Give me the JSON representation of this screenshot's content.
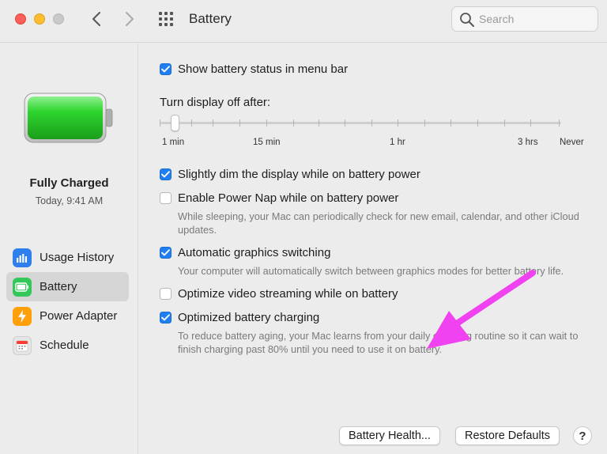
{
  "window": {
    "title": "Battery"
  },
  "search": {
    "placeholder": "Search"
  },
  "sidebar": {
    "status_title": "Fully Charged",
    "status_time": "Today, 9:41 AM",
    "items": [
      {
        "label": "Usage History",
        "icon": "bar-chart-icon",
        "color": "#2f80ed"
      },
      {
        "label": "Battery",
        "icon": "battery-icon",
        "color": "#34c759",
        "active": true
      },
      {
        "label": "Power Adapter",
        "icon": "lightning-icon",
        "color": "#ff9f0a"
      },
      {
        "label": "Schedule",
        "icon": "calendar-icon",
        "color": "#e5e5e5"
      }
    ]
  },
  "settings": {
    "show_status": {
      "label": "Show battery status in menu bar",
      "checked": true
    },
    "display_off": {
      "label": "Turn display off after:",
      "ticks": [
        "1 min",
        "15 min",
        "1 hr",
        "3 hrs",
        "Never"
      ],
      "selected": "1 min"
    },
    "dim_display": {
      "label": "Slightly dim the display while on battery power",
      "checked": true
    },
    "power_nap": {
      "label": "Enable Power Nap while on battery power",
      "checked": false,
      "description": "While sleeping, your Mac can periodically check for new email, calendar, and other iCloud updates."
    },
    "graphics_switching": {
      "label": "Automatic graphics switching",
      "checked": true,
      "description": "Your computer will automatically switch between graphics modes for better battery life."
    },
    "video_streaming": {
      "label": "Optimize video streaming while on battery",
      "checked": false
    },
    "optimized_charging": {
      "label": "Optimized battery charging",
      "checked": true,
      "description": "To reduce battery aging, your Mac learns from your daily charging routine so it can wait to finish charging past 80% until you need to use it on battery."
    }
  },
  "buttons": {
    "battery_health": "Battery Health...",
    "restore_defaults": "Restore Defaults",
    "help": "?"
  },
  "colors": {
    "accent": "#1f7ef0",
    "annotation_arrow": "#f042f0",
    "battery_fill": "#2fd52f"
  }
}
